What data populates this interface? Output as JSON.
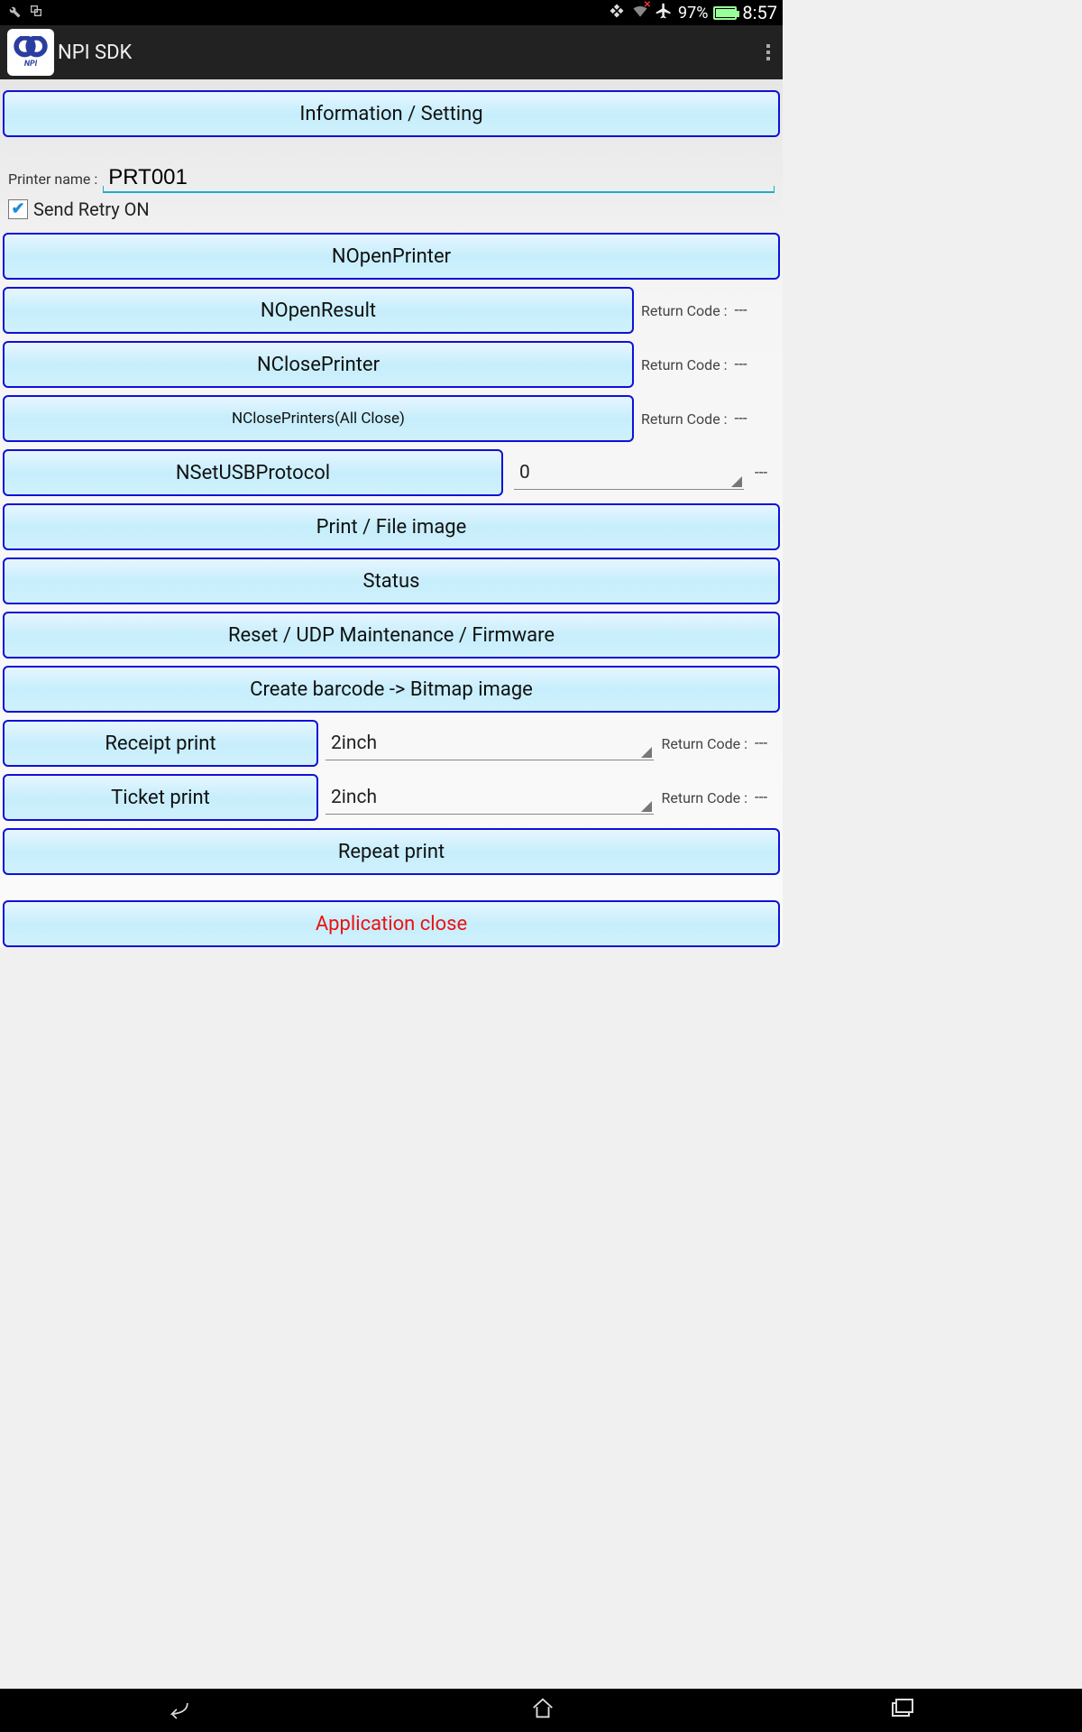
{
  "status_bar": {
    "battery": "97%",
    "clock": "8:57"
  },
  "app": {
    "title": "NPI SDK",
    "icon_label": "NPI"
  },
  "buttons": {
    "info_setting": "Information / Setting",
    "nopen_printer": "NOpenPrinter",
    "nopen_result": "NOpenResult",
    "nclose_printer": "NClosePrinter",
    "nclose_all": "NClosePrinters(All Close)",
    "nset_usb": "NSetUSBProtocol",
    "print_file": "Print / File image",
    "status": "Status",
    "reset": "Reset / UDP Maintenance / Firmware",
    "barcode": "Create barcode -> Bitmap image",
    "receipt": "Receipt print",
    "ticket": "Ticket print",
    "repeat": "Repeat print",
    "app_close": "Application close"
  },
  "labels": {
    "printer_name": "Printer name :",
    "send_retry": "Send Retry ON",
    "return_code": "Return Code :"
  },
  "values": {
    "printer_name": "PRT001",
    "usb_protocol": "0",
    "receipt_size": "2inch",
    "ticket_size": "2inch",
    "rc_placeholder": "---"
  },
  "checks": {
    "send_retry": true
  }
}
